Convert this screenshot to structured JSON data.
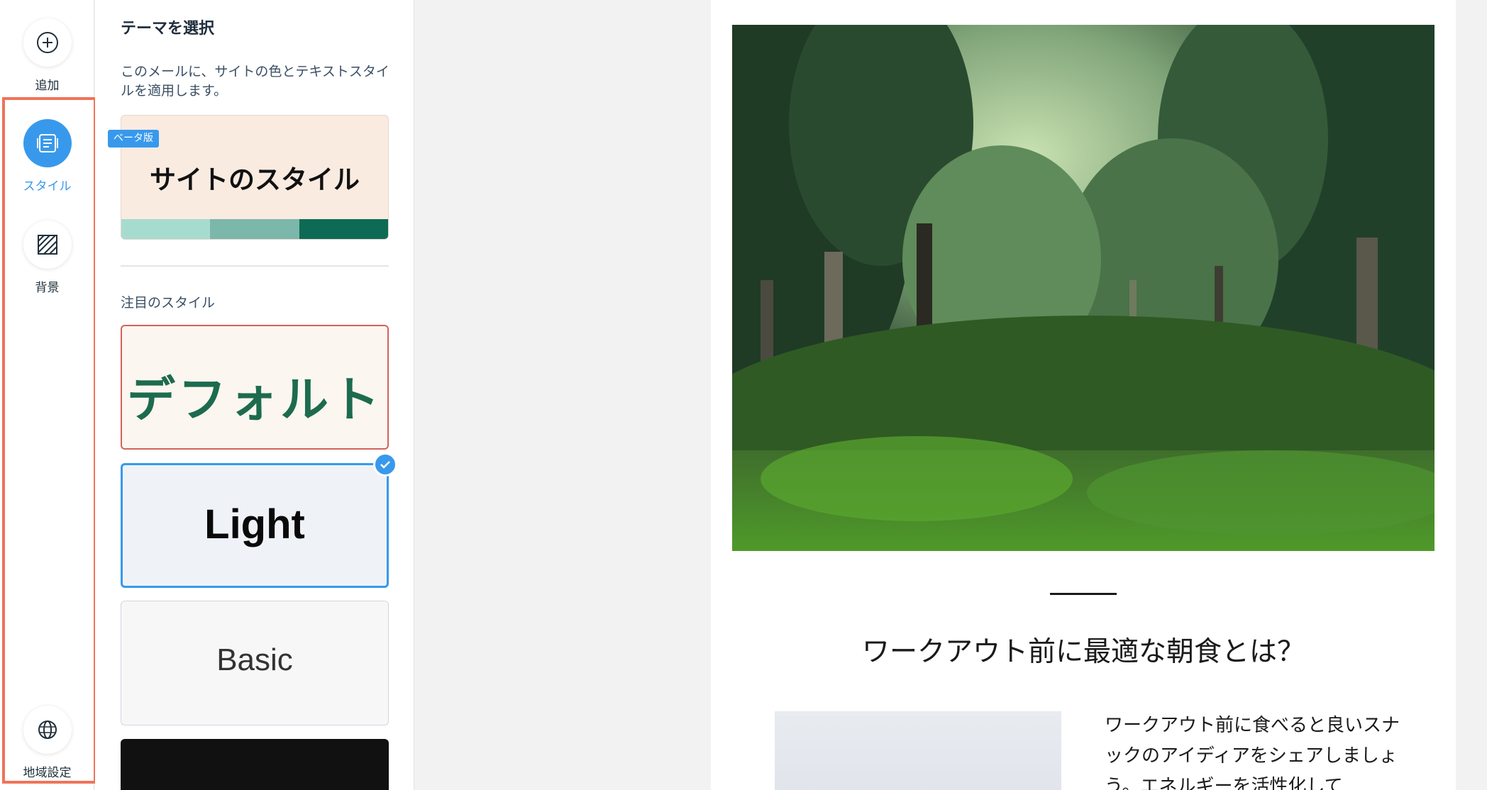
{
  "rail": {
    "add_label": "追加",
    "style_label": "スタイル",
    "background_label": "背景",
    "locale_label": "地域設定"
  },
  "panel": {
    "title": "テーマを選択",
    "description": "このメールに、サイトの色とテキストスタイルを適用します。",
    "beta_badge": "ベータ版",
    "site_style_name": "サイトのスタイル",
    "site_palette": [
      "#a6dccf",
      "#7bb7aa",
      "#0d6b55"
    ],
    "featured_label": "注目のスタイル",
    "themes": [
      {
        "name": "デフォルト",
        "selected": false
      },
      {
        "name": "Light",
        "selected": true
      },
      {
        "name": "Basic",
        "selected": false
      }
    ]
  },
  "email": {
    "headline": "ワークアウト前に最適な朝食とは？",
    "body": "ワークアウト前に食べると良いスナックのアイディアをシェアしましょう。エネルギーを活性化して"
  },
  "colors": {
    "accent": "#3899ec",
    "highlight": "#f0735a"
  }
}
